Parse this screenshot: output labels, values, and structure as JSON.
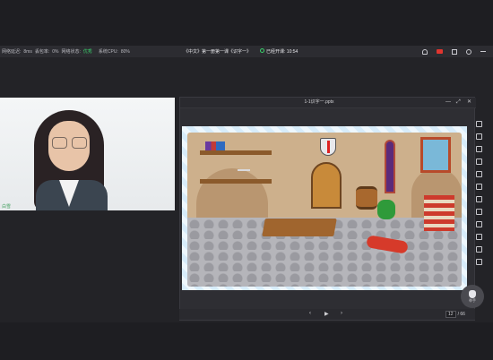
{
  "status_bar": {
    "network_delay_label": "网络延迟:",
    "network_delay_value": "8ms",
    "packet_loss_label": "丢包率:",
    "packet_loss_value": "0%",
    "network_status_label": "网络状态:",
    "network_status_value": "优秀",
    "cpu_label": "系统CPU:",
    "cpu_value": "80%",
    "lesson_title": "《中文》第一册第一课《识字一》",
    "class_started_label": "已经开课:",
    "class_elapsed": "10:54"
  },
  "video": {
    "name_tag": "白雪"
  },
  "ppt_window": {
    "title": "1-1识字一.pptx",
    "controls": [
      "—",
      "⤢",
      "✕"
    ]
  },
  "nav": {
    "prev": "‹",
    "play": "▶",
    "next": "›",
    "current_page": "12",
    "total_pages": "/ 66"
  },
  "hand_button": {
    "label": "举手"
  },
  "colors": {
    "status_good": "#3ad06b",
    "record": "#e0352f",
    "background": "#232327"
  }
}
